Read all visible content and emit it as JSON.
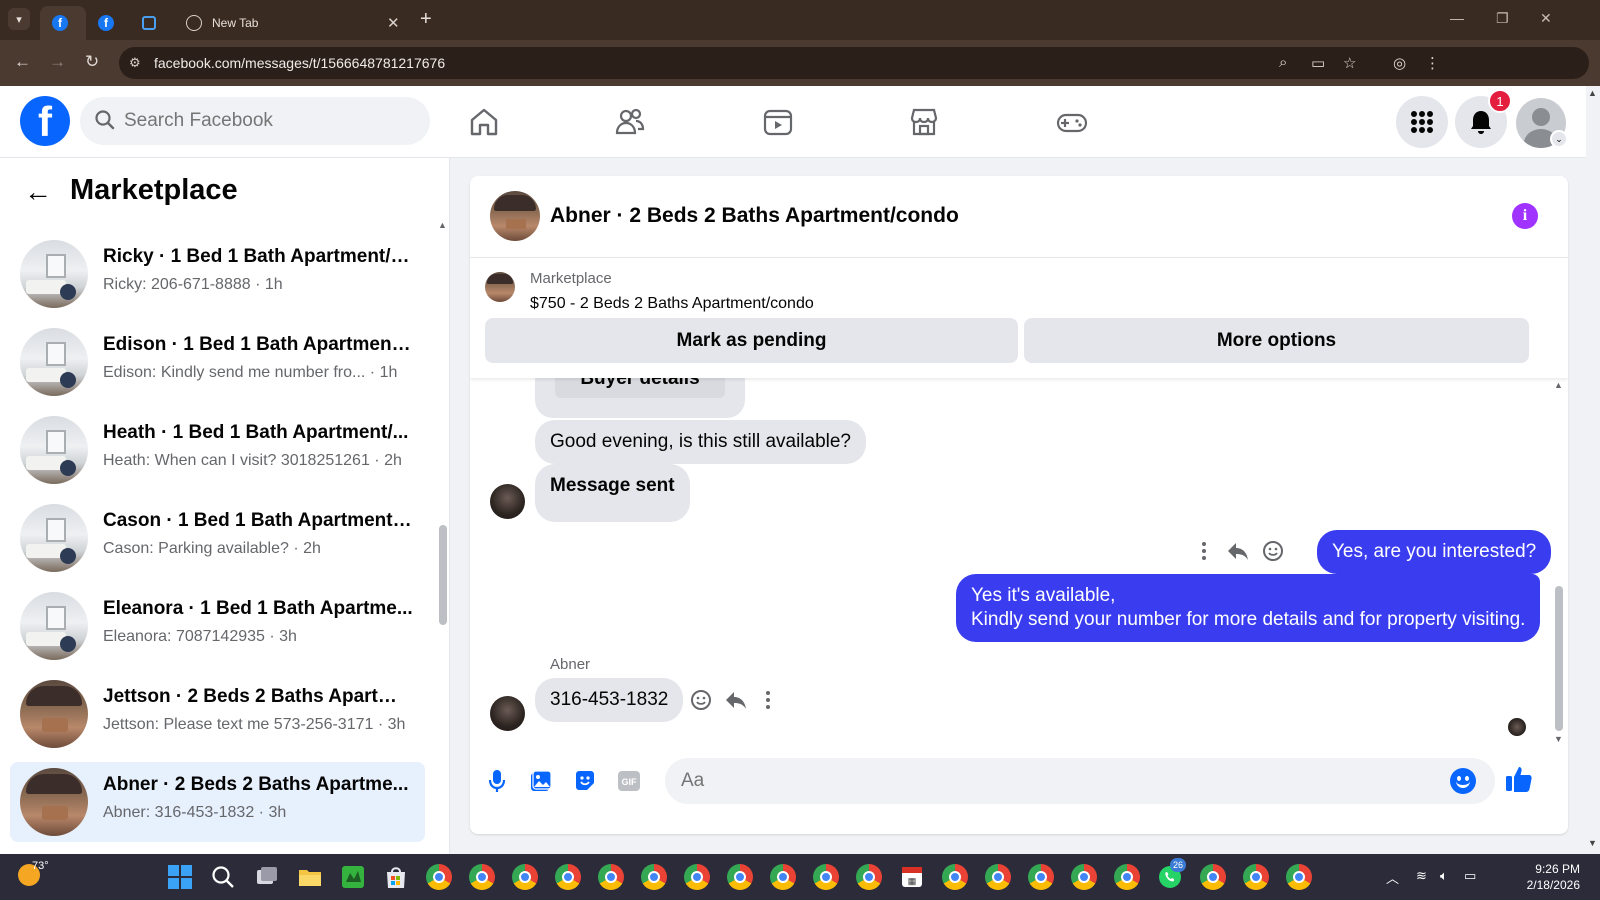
{
  "browser": {
    "tabs": [
      {
        "label": "",
        "icon": "facebook-icon"
      },
      {
        "label": "",
        "icon": "facebook-icon"
      },
      {
        "label": "",
        "icon": "document-icon"
      },
      {
        "label": "New Tab",
        "icon": "globe-icon"
      }
    ],
    "url": "facebook.com/messages/t/1566648781217676"
  },
  "facebook": {
    "search_placeholder": "Search Facebook",
    "notification_count": "1",
    "brand_color": "#0866ff"
  },
  "sidebar": {
    "title": "Marketplace",
    "conversations": [
      {
        "name": "Ricky · 1 Bed 1 Bath Apartment/c...",
        "preview": "Ricky: 206-671-8888 · 1h",
        "thumb": "room"
      },
      {
        "name": "Edison · 1 Bed 1 Bath Apartment/...",
        "preview": "Edison: Kindly send me number fro... · 1h",
        "thumb": "room"
      },
      {
        "name": "Heath · 1 Bed 1 Bath Apartment/...",
        "preview": "Heath: When can I visit? 3018251261 · 2h",
        "thumb": "room"
      },
      {
        "name": "Cason · 1 Bed 1 Bath Apartment/...",
        "preview": "Cason: Parking available? · 2h",
        "thumb": "room"
      },
      {
        "name": "Eleanora · 1 Bed 1 Bath Apartme...",
        "preview": "Eleanora: 7087142935 · 3h",
        "thumb": "room"
      },
      {
        "name": "Jettson · 2 Beds 2 Baths Apartme...",
        "preview": "Jettson: Please text me 573-256-3171 · 3h",
        "thumb": "patio"
      },
      {
        "name": "Abner · 2 Beds 2 Baths Apartme...",
        "preview": "Abner: 316-453-1832 · 3h",
        "thumb": "patio"
      }
    ]
  },
  "chat": {
    "title": "Abner · 2 Beds 2 Baths Apartment/condo",
    "listing_label": "Marketplace",
    "listing_price": "$750 - 2 Beds 2 Baths Apartment/condo",
    "mark_pending": "Mark as pending",
    "more_options": "More options",
    "buyer_details": "Buyer details",
    "messages": {
      "m1": "Good evening, is this still available?",
      "m2": "Message sent",
      "m3": "Yes, are you interested?",
      "m4_line1": "Yes it's available,",
      "m4_line2": "Kindly send your number for more details and for property visiting.",
      "sender": "Abner",
      "m5": "316-453-1832"
    },
    "composer_placeholder": "Aa",
    "outgoing_color": "#3a3cf0"
  },
  "taskbar": {
    "temperature": "73°",
    "time": "9:26 PM",
    "date": "2/18/2026",
    "whatsapp_badge": "26"
  }
}
